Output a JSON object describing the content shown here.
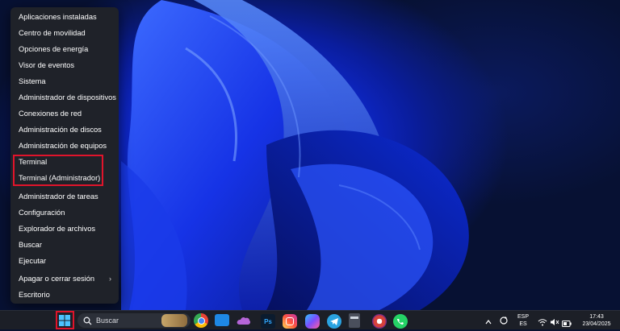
{
  "menu": {
    "items": [
      {
        "label": "Aplicaciones instaladas"
      },
      {
        "label": "Centro de movilidad"
      },
      {
        "label": "Opciones de energía"
      },
      {
        "label": "Visor de eventos"
      },
      {
        "label": "Sistema"
      },
      {
        "label": "Administrador de dispositivos"
      },
      {
        "label": "Conexiones de red"
      },
      {
        "label": "Administración de discos"
      },
      {
        "label": "Administración de equipos"
      },
      {
        "label": "Terminal"
      },
      {
        "label": "Terminal (Administrador)"
      },
      {
        "label": "Administrador de tareas"
      },
      {
        "label": "Configuración"
      },
      {
        "label": "Explorador de archivos"
      },
      {
        "label": "Buscar"
      },
      {
        "label": "Ejecutar"
      },
      {
        "label": "Apagar o cerrar sesión",
        "chevron": "›"
      },
      {
        "label": "Escritorio"
      }
    ]
  },
  "taskbar": {
    "search_label": "Buscar",
    "apps": [
      "chrome-icon",
      "file-explorer-icon",
      "onedrive-icon",
      "photoshop-icon",
      "instagram-icon",
      "copilot-icon",
      "telegram-icon",
      "calculator-icon",
      "app-icon",
      "whatsapp-icon"
    ],
    "photoshop_label": "Ps",
    "language_top": "ESP",
    "language_bottom": "ES",
    "time": "17:43",
    "date": "23/04/2025"
  },
  "colors": {
    "menu_bg": "#1f2229",
    "highlight_red": "#e0142b",
    "taskbar_bg": "#1c1f27",
    "wallpaper_blue": "#1a3cff"
  }
}
